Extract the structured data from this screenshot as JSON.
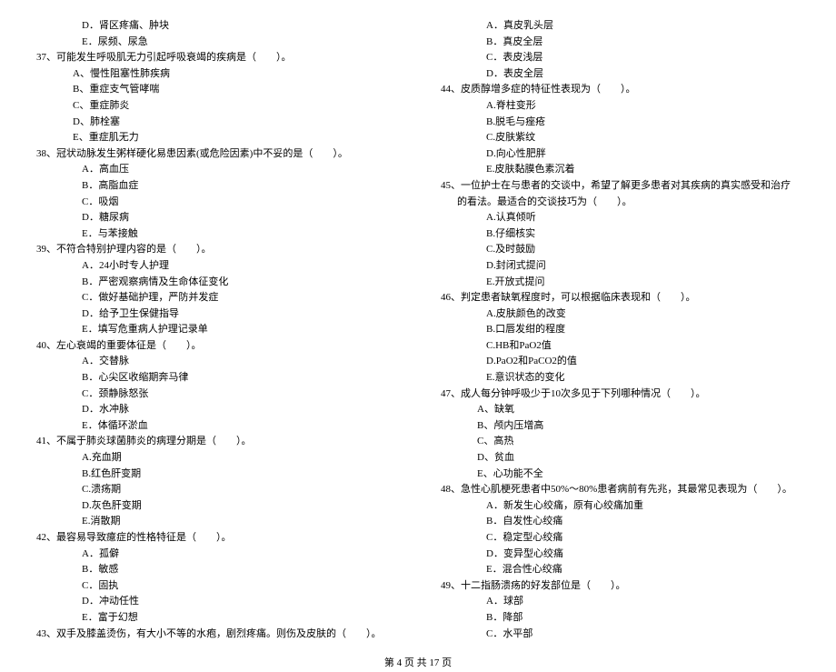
{
  "left": {
    "q36_opts": {
      "d": "D．肾区疼痛、肿块",
      "e": "E．尿频、尿急"
    },
    "q37": {
      "text": "37、可能发生呼吸肌无力引起呼吸衰竭的疾病是（　　）。",
      "a": "A、慢性阻塞性肺疾病",
      "b": "B、重症支气管哮喘",
      "c": "C、重症肺炎",
      "d": "D、肺栓塞",
      "e": "E、重症肌无力"
    },
    "q38": {
      "text": "38、冠状动脉发生粥样硬化易患因素(或危险因素)中不妥的是（　　）。",
      "a": "A．高血压",
      "b": "B．高脂血症",
      "c": "C．吸烟",
      "d": "D．糖尿病",
      "e": "E．与苯接触"
    },
    "q39": {
      "text": "39、不符合特别护理内容的是（　　）。",
      "a": "A．24小时专人护理",
      "b": "B．严密观察病情及生命体征变化",
      "c": "C．做好基础护理，严防并发症",
      "d": "D．给予卫生保健指导",
      "e": "E．填写危重病人护理记录单"
    },
    "q40": {
      "text": "40、左心衰竭的重要体征是（　　）。",
      "a": "A．交替脉",
      "b": "B．心尖区收缩期奔马律",
      "c": "C．颈静脉怒张",
      "d": "D．水冲脉",
      "e": "E．体循环淤血"
    },
    "q41": {
      "text": "41、不属于肺炎球菌肺炎的病理分期是（　　）。",
      "a": "A.充血期",
      "b": "B.红色肝变期",
      "c": "C.溃疡期",
      "d": "D.灰色肝变期",
      "e": "E.消散期"
    },
    "q42": {
      "text": "42、最容易导致癔症的性格特征是（　　）。",
      "a": "A．孤僻",
      "b": "B．敏感",
      "c": "C．固执",
      "d": "D．冲动任性",
      "e": "E．富于幻想"
    },
    "q43": {
      "text": "43、双手及膝盖烫伤，有大小不等的水疱，剧烈疼痛。则伤及皮肤的（　　）。"
    }
  },
  "right": {
    "q43_opts": {
      "a": "A．真皮乳头层",
      "b": "B．真皮全层",
      "c": "C．表皮浅层",
      "d": "D．表皮全层"
    },
    "q44": {
      "text": "44、皮质醇增多症的特征性表现为（　　）。",
      "a": "A.脊柱变形",
      "b": "B.脱毛与痤疮",
      "c": "C.皮肤紫纹",
      "d": "D.向心性肥胖",
      "e": "E.皮肤黏膜色素沉着"
    },
    "q45": {
      "text": "45、一位护士在与患者的交谈中，希望了解更多患者对其疾病的真实感受和治疗的看法。最适合的交谈技巧为（　　）。",
      "a": "A.认真倾听",
      "b": "B.仔细核实",
      "c": "C.及时鼓励",
      "d": "D.封闭式提问",
      "e": "E.开放式提问"
    },
    "q46": {
      "text": "46、判定患者缺氧程度时，可以根据临床表现和（　　）。",
      "a": "A.皮肤颜色的改变",
      "b": "B.口唇发绀的程度",
      "c": "C.HB和PaO2值",
      "d": "D.PaO2和PaCO2的值",
      "e": "E.意识状态的变化"
    },
    "q47": {
      "text": "47、成人每分钟呼吸少于10次多见于下列哪种情况（　　）。",
      "a": "A、缺氧",
      "b": "B、颅内压增高",
      "c": "C、高热",
      "d": "D、贫血",
      "e": "E、心功能不全"
    },
    "q48": {
      "text": "48、急性心肌梗死患者中50%～80%患者病前有先兆，其最常见表现为（　　）。",
      "a": "A．新发生心绞痛，原有心绞痛加重",
      "b": "B．自发性心绞痛",
      "c": "C．稳定型心绞痛",
      "d": "D．变异型心绞痛",
      "e": "E．混合性心绞痛"
    },
    "q49": {
      "text": "49、十二指肠溃疡的好发部位是（　　）。",
      "a": "A．球部",
      "b": "B．降部",
      "c": "C．水平部"
    }
  },
  "footer": "第 4 页 共 17 页"
}
